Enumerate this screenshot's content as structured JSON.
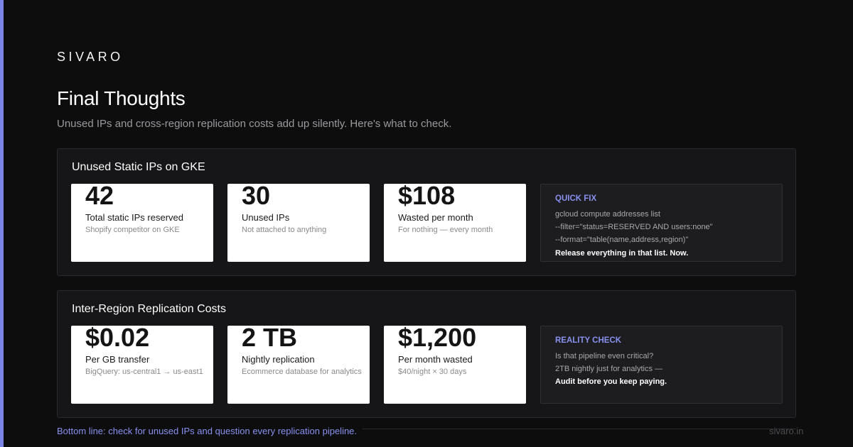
{
  "brand": "SIVARO",
  "title": "Final Thoughts",
  "subtitle": "Unused IPs and cross-region replication costs add up silently. Here's what to check.",
  "sections": [
    {
      "title": "Unused Static IPs on GKE",
      "stats": [
        {
          "value": "42",
          "label": "Total static IPs reserved",
          "note": "Shopify competitor on GKE"
        },
        {
          "value": "30",
          "label": "Unused IPs",
          "note": "Not attached to anything"
        },
        {
          "value": "$108",
          "label": "Wasted per month",
          "note": "For nothing — every month"
        }
      ],
      "callout": {
        "title": "QUICK FIX",
        "lines": [
          "gcloud compute addresses list",
          "--filter=\"status=RESERVED AND users:none\"",
          "--format=\"table(name,address,region)\""
        ],
        "strong": "Release everything in that list. Now."
      }
    },
    {
      "title": "Inter-Region Replication Costs",
      "stats": [
        {
          "value": "$0.02",
          "label": "Per GB transfer",
          "note": "BigQuery: us-central1 → us-east1"
        },
        {
          "value": "2 TB",
          "label": "Nightly replication",
          "note": "Ecommerce database for analytics"
        },
        {
          "value": "$1,200",
          "label": "Per month wasted",
          "note": "$40/night × 30 days"
        }
      ],
      "callout": {
        "title": "REALITY CHECK",
        "lines": [
          "Is that pipeline even critical?",
          "2TB nightly just for analytics —"
        ],
        "strong": "Audit before you keep paying."
      }
    }
  ],
  "footer": {
    "bottom_line": "Bottom line: check for unused IPs and question every replication pipeline.",
    "domain": "sivaro.in"
  },
  "colors": {
    "accent": "#7b86e8",
    "callout_title": "#8891ee",
    "background": "#0d0d0e"
  }
}
